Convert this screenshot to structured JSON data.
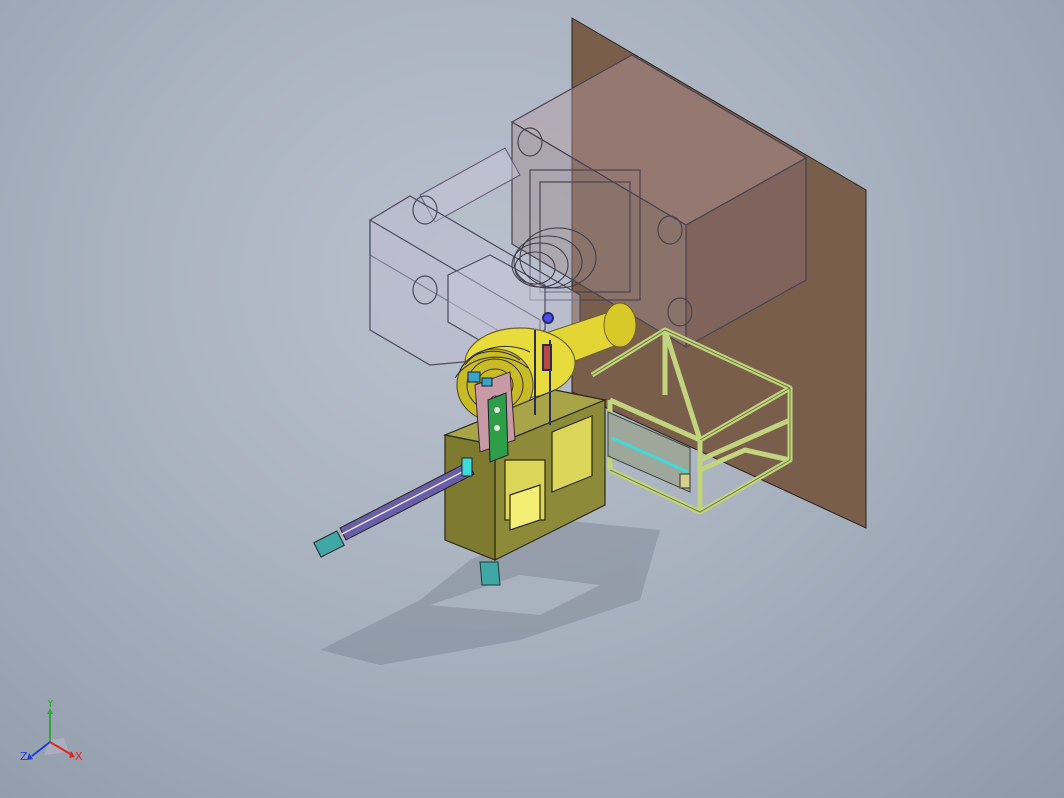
{
  "viewport": {
    "background_top": "#b9c1cd",
    "background_bottom": "#8f99a8",
    "model_colors": {
      "mold_plate": "#7a5e4c",
      "mold_block": "#9a8585",
      "transparent_housing": "#b8b6c6",
      "yellow_cylinder": "#e3d634",
      "olive_carriage": "#8d8a3a",
      "green_frame": "#d6e89a",
      "rail": "#3fa7a6",
      "rod": "#6a5fa6",
      "bracket": "#2f9e49"
    }
  },
  "triad": {
    "x_label": "X",
    "y_label": "Y",
    "z_label": "Z",
    "x_color": "#e0281e",
    "y_color": "#2ea63a",
    "z_color": "#1c3fd8"
  }
}
